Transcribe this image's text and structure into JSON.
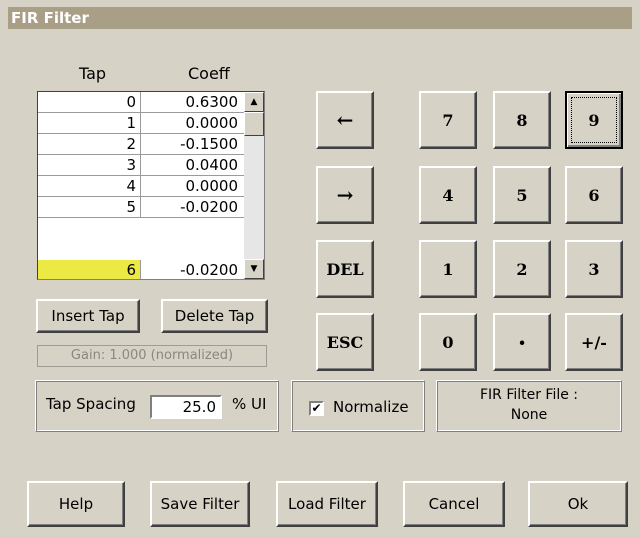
{
  "window": {
    "title": "FIR Filter"
  },
  "table": {
    "headers": {
      "tap": "Tap",
      "coeff": "Coeff"
    },
    "rows": [
      {
        "tap": "0",
        "coeff": "0.6300"
      },
      {
        "tap": "1",
        "coeff": "0.0000"
      },
      {
        "tap": "2",
        "coeff": "-0.1500"
      },
      {
        "tap": "3",
        "coeff": "0.0400"
      },
      {
        "tap": "4",
        "coeff": "0.0000"
      },
      {
        "tap": "5",
        "coeff": "-0.0200"
      },
      {
        "tap": "6",
        "coeff": "-0.0200"
      }
    ],
    "selected_row": 6,
    "selected_color": "#ece844",
    "scroll_up_icon": "triangle-up",
    "scroll_down_icon": "triangle-down"
  },
  "tap_buttons": {
    "insert": "Insert Tap",
    "delete": "Delete Tap"
  },
  "gain_text": "Gain: 1.000 (normalized)",
  "tap_spacing": {
    "label": "Tap Spacing",
    "value": "25.0",
    "unit": "% UI"
  },
  "normalize": {
    "label": "Normalize",
    "checked": true,
    "check_glyph": "✔"
  },
  "fir_file": {
    "label": "FIR Filter File :",
    "value": "None"
  },
  "keypad": {
    "left": "←",
    "right": "→",
    "del": "DEL",
    "esc": "ESC",
    "k7": "7",
    "k8": "8",
    "k9": "9",
    "k4": "4",
    "k5": "5",
    "k6": "6",
    "k1": "1",
    "k2": "2",
    "k3": "3",
    "k0": "0",
    "dot": "·",
    "plusminus": "+/-"
  },
  "bottom_buttons": {
    "help": "Help",
    "save": "Save Filter",
    "load": "Load Filter",
    "cancel": "Cancel",
    "ok": "Ok"
  }
}
